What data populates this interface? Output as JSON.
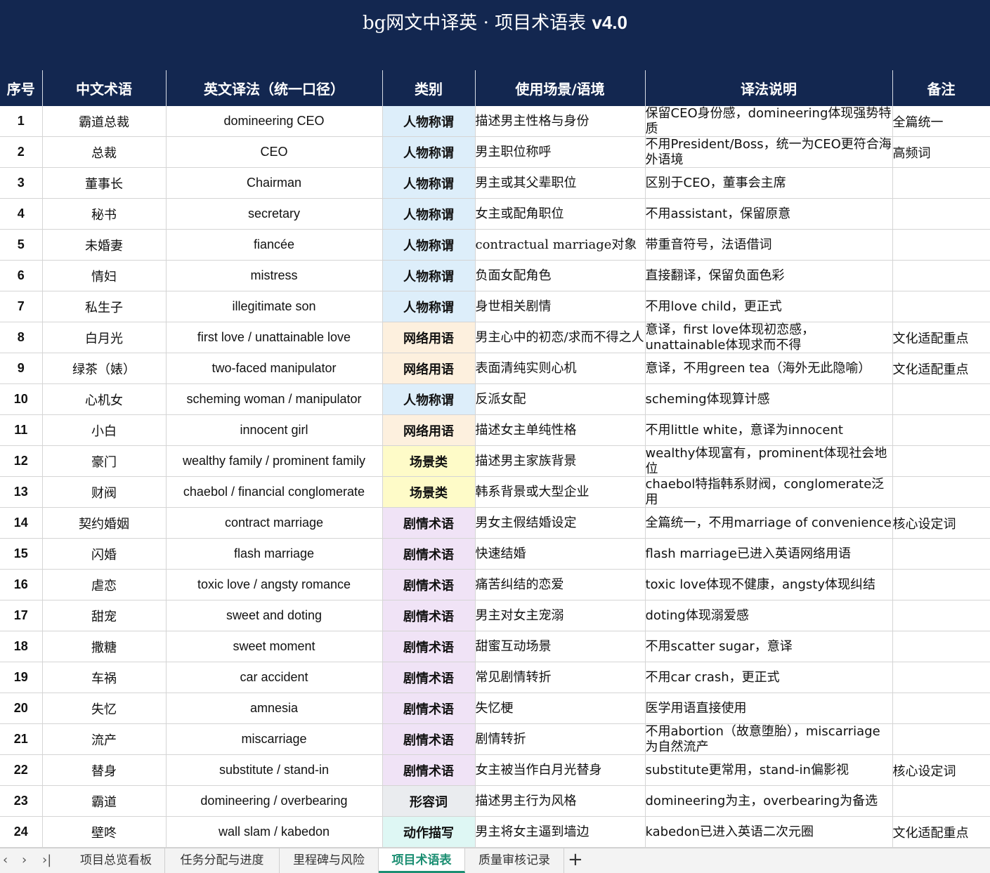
{
  "sheet_title_plain": "bg网文中译英 · 项目术语表 ",
  "sheet_title_version": "v4.0",
  "headers": [
    "序号",
    "中文术语",
    "英文译法（统一口径）",
    "类别",
    "使用场景/语境",
    "译法说明",
    "备注"
  ],
  "category_colors": {
    "cat-person": "#ddeefa",
    "cat-net": "#fdf0de",
    "cat-scene": "#fefbc8",
    "cat-plot": "#f0e3f6",
    "cat-adj": "#eaecef",
    "cat-act": "#def7f4"
  },
  "rows": [
    {
      "no": "1",
      "zh": "霸道总裁",
      "en": "domineering CEO",
      "cat": "人物称谓",
      "cat_class": "cat-person",
      "ctx": "描述男主性格与身份",
      "note": "保留CEO身份感，domineering体现强势特质",
      "rem": "全篇统一"
    },
    {
      "no": "2",
      "zh": "总裁",
      "en": "CEO",
      "cat": "人物称谓",
      "cat_class": "cat-person",
      "ctx": "男主职位称呼",
      "note": "不用President/Boss，统一为CEO更符合海外语境",
      "rem": "高频词"
    },
    {
      "no": "3",
      "zh": "董事长",
      "en": "Chairman",
      "cat": "人物称谓",
      "cat_class": "cat-person",
      "ctx": "男主或其父辈职位",
      "note": "区别于CEO，董事会主席",
      "rem": ""
    },
    {
      "no": "4",
      "zh": "秘书",
      "en": "secretary",
      "cat": "人物称谓",
      "cat_class": "cat-person",
      "ctx": "女主或配角职位",
      "note": "不用assistant，保留原意",
      "rem": ""
    },
    {
      "no": "5",
      "zh": "未婚妻",
      "en": "fiancée",
      "cat": "人物称谓",
      "cat_class": "cat-person",
      "ctx": " contractual marriage对象",
      "note": "带重音符号，法语借词",
      "rem": ""
    },
    {
      "no": "6",
      "zh": "情妇",
      "en": "mistress",
      "cat": "人物称谓",
      "cat_class": "cat-person",
      "ctx": "负面女配角色",
      "note": "直接翻译，保留负面色彩",
      "rem": ""
    },
    {
      "no": "7",
      "zh": "私生子",
      "en": "illegitimate son",
      "cat": "人物称谓",
      "cat_class": "cat-person",
      "ctx": "身世相关剧情",
      "note": "不用love child，更正式",
      "rem": ""
    },
    {
      "no": "8",
      "zh": "白月光",
      "en": "first love / unattainable love",
      "cat": "网络用语",
      "cat_class": "cat-net",
      "ctx": "男主心中的初恋/求而不得之人",
      "note": "意译，first love体现初恋感，unattainable体现求而不得",
      "rem": "文化适配重点"
    },
    {
      "no": "9",
      "zh": "绿茶（婊）",
      "en": "two-faced manipulator",
      "cat": "网络用语",
      "cat_class": "cat-net",
      "ctx": "表面清纯实则心机",
      "note": "意译，不用green tea（海外无此隐喻）",
      "rem": "文化适配重点"
    },
    {
      "no": "10",
      "zh": "心机女",
      "en": "scheming woman / manipulator",
      "cat": "人物称谓",
      "cat_class": "cat-person",
      "ctx": "反派女配",
      "note": "scheming体现算计感",
      "rem": ""
    },
    {
      "no": "11",
      "zh": "小白",
      "en": "innocent girl",
      "cat": "网络用语",
      "cat_class": "cat-net",
      "ctx": "描述女主单纯性格",
      "note": "不用little white，意译为innocent",
      "rem": ""
    },
    {
      "no": "12",
      "zh": "豪门",
      "en": "wealthy family / prominent family",
      "cat": "场景类",
      "cat_class": "cat-scene",
      "ctx": "描述男主家族背景",
      "note": "wealthy体现富有，prominent体现社会地位",
      "rem": ""
    },
    {
      "no": "13",
      "zh": "财阀",
      "en": "chaebol / financial conglomerate",
      "cat": "场景类",
      "cat_class": "cat-scene",
      "ctx": "韩系背景或大型企业",
      "note": "chaebol特指韩系财阀，conglomerate泛用",
      "rem": ""
    },
    {
      "no": "14",
      "zh": "契约婚姻",
      "en": "contract marriage",
      "cat": "剧情术语",
      "cat_class": "cat-plot",
      "ctx": "男女主假结婚设定",
      "note": "全篇统一，不用marriage of convenience",
      "rem": "核心设定词"
    },
    {
      "no": "15",
      "zh": "闪婚",
      "en": "flash marriage",
      "cat": "剧情术语",
      "cat_class": "cat-plot",
      "ctx": "快速结婚",
      "note": "flash marriage已进入英语网络用语",
      "rem": ""
    },
    {
      "no": "16",
      "zh": "虐恋",
      "en": "toxic love / angsty romance",
      "cat": "剧情术语",
      "cat_class": "cat-plot",
      "ctx": "痛苦纠结的恋爱",
      "note": "toxic love体现不健康，angsty体现纠结",
      "rem": ""
    },
    {
      "no": "17",
      "zh": "甜宠",
      "en": "sweet and doting",
      "cat": "剧情术语",
      "cat_class": "cat-plot",
      "ctx": "男主对女主宠溺",
      "note": "doting体现溺爱感",
      "rem": ""
    },
    {
      "no": "18",
      "zh": "撒糖",
      "en": "sweet moment",
      "cat": "剧情术语",
      "cat_class": "cat-plot",
      "ctx": "甜蜜互动场景",
      "note": "不用scatter sugar，意译",
      "rem": ""
    },
    {
      "no": "19",
      "zh": "车祸",
      "en": "car accident",
      "cat": "剧情术语",
      "cat_class": "cat-plot",
      "ctx": "常见剧情转折",
      "note": "不用car crash，更正式",
      "rem": ""
    },
    {
      "no": "20",
      "zh": "失忆",
      "en": "amnesia",
      "cat": "剧情术语",
      "cat_class": "cat-plot",
      "ctx": "失忆梗",
      "note": "医学用语直接使用",
      "rem": ""
    },
    {
      "no": "21",
      "zh": "流产",
      "en": "miscarriage",
      "cat": "剧情术语",
      "cat_class": "cat-plot",
      "ctx": "剧情转折",
      "note": "不用abortion（故意堕胎），miscarriage为自然流产",
      "rem": ""
    },
    {
      "no": "22",
      "zh": "替身",
      "en": "substitute / stand-in",
      "cat": "剧情术语",
      "cat_class": "cat-plot",
      "ctx": "女主被当作白月光替身",
      "note": "substitute更常用，stand-in偏影视",
      "rem": "核心设定词"
    },
    {
      "no": "23",
      "zh": "霸道",
      "en": "domineering / overbearing",
      "cat": "形容词",
      "cat_class": "cat-adj",
      "ctx": "描述男主行为风格",
      "note": "domineering为主，overbearing为备选",
      "rem": ""
    },
    {
      "no": "24",
      "zh": "壁咚",
      "en": "wall slam / kabedon",
      "cat": "动作描写",
      "cat_class": "cat-act",
      "ctx": "男主将女主逼到墙边",
      "note": "kabedon已进入英语二次元圈",
      "rem": "文化适配重点"
    }
  ],
  "tabs": [
    {
      "label": "项目总览看板",
      "active": false
    },
    {
      "label": "任务分配与进度",
      "active": false
    },
    {
      "label": "里程碑与风险",
      "active": false
    },
    {
      "label": "项目术语表",
      "active": true
    },
    {
      "label": "质量审核记录",
      "active": false
    }
  ],
  "nav": {
    "prev": "‹",
    "next": "›",
    "last": "›|"
  },
  "add_tab": "+"
}
